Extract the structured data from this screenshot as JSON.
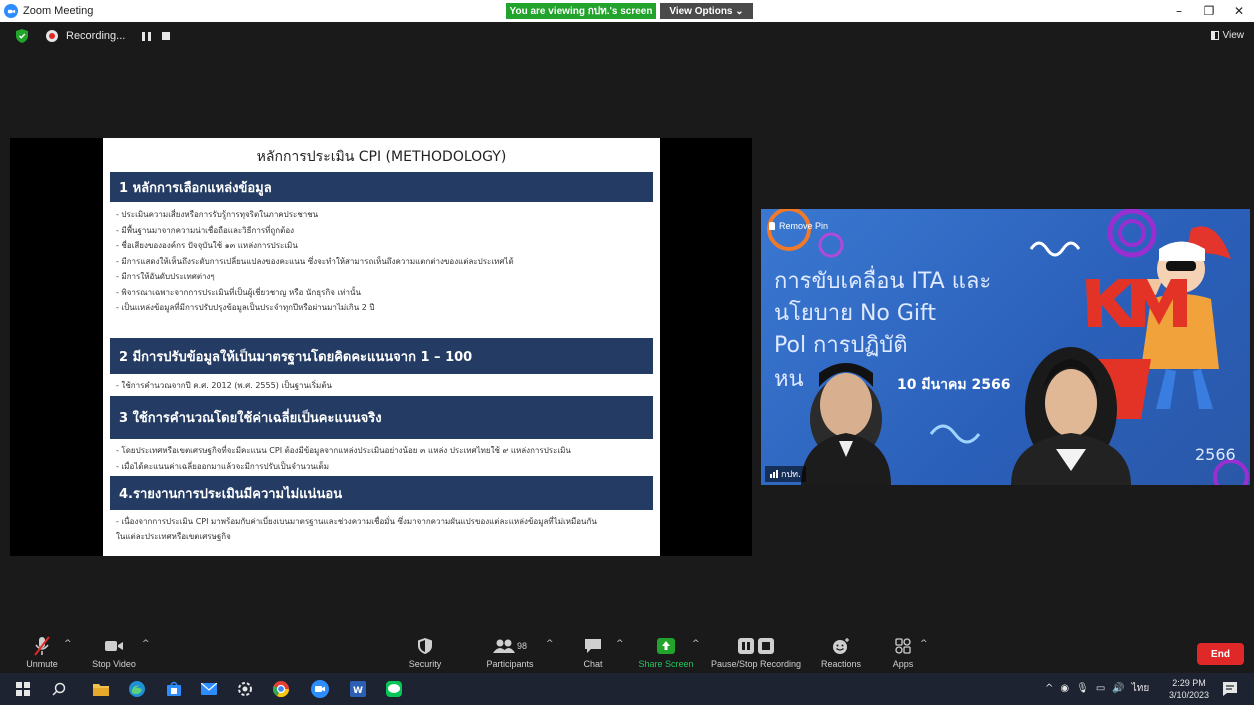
{
  "window": {
    "title": "Zoom Meeting"
  },
  "banner": {
    "viewing": "You are viewing กปท.'s screen",
    "view_options": "View Options ⌄"
  },
  "recording": {
    "label": "Recording...",
    "view": "View"
  },
  "slide": {
    "title": "หลักการประเมิน CPI (METHODOLOGY)",
    "s1": "1 หลักการเลือกแหล่งข้อมูล",
    "s1_items": [
      "- ประเมินความเสี่ยงหรือการรับรู้การทุจริตในภาคประชาชน",
      "- มีพื้นฐานมาจากความน่าเชื่อถือและวิธีการที่ถูกต้อง",
      "- ชื่อเสียงขององค์กร ปัจจุบันใช้ ๑๓ แหล่งการประเมิน",
      "- มีการแสดงให้เห็นถึงระดับการเปลี่ยนแปลงของคะแนน ซึ่งจะทำให้สามารถเห็นถึงความแตกต่างของแต่ละประเทศได้",
      "- มีการให้อันดับประเทศต่างๆ",
      "- พิจารณาเฉพาะจากการประเมินที่เป็นผู้เชี่ยวชาญ หรือ นักธุรกิจ เท่านั้น",
      "- เป็นแหล่งข้อมูลที่มีการปรับปรุงข้อมูลเป็นประจำทุกปีหรือผ่านมาไม่เกิน 2 ปี"
    ],
    "s2": "2 มีการปรับข้อมูลให้เป็นมาตรฐานโดยคิดคะแนนจาก 1 – 100",
    "s2_item": "- ใช้การคำนวณจากปี ค.ศ. 2012 (พ.ศ. 2555) เป็นฐานเริ่มต้น",
    "s3": "3 ใช้การคำนวณโดยใช้ค่าเฉลี่ยเป็นคะแนนจริง",
    "s3_items": [
      "- โดยประเทศหรือเขตเศรษฐกิจที่จะมีคะแนน CPI ต้องมีข้อมูลจากแหล่งประเมินอย่างน้อย ๓ แหล่ง ประเทศไทยใช้ ๙ แหล่งการประเมิน",
      "- เมื่อได้คะแนนค่าเฉลี่ยออกมาแล้วจะมีการปรับเป็นจำนวนเต็ม"
    ],
    "s4": "4.รายงานการประเมินมีความไม่แน่นอน",
    "s4_items": [
      "- เนื่องจากการประเมิน CPI มาพร้อมกับค่าเบี่ยงเบนมาตรฐานและช่วงความเชื่อมั่น ซึ่งมาจากความผันแปรของแต่ละแหล่งข้อมูลที่ไม่เหมือนกัน",
      "ในแต่ละประเทศหรือเขตเศรษฐกิจ"
    ]
  },
  "video": {
    "remove_pin": "Remove Pin",
    "line1": "การขับเคลื่อน ITA และ",
    "line2": "นโยบาย No Gift",
    "line3": "Pol      การปฏิบัติ",
    "line4": "หน",
    "date": "10 มีนาคม 2566",
    "year": "2566",
    "big_letters": "KM",
    "participant_name": "กปท."
  },
  "toolbar": {
    "unmute": "Unmute",
    "stop_video": "Stop Video",
    "security": "Security",
    "participants": "Participants",
    "participants_count": "98",
    "chat": "Chat",
    "share_screen": "Share Screen",
    "pause_recording": "Pause/Stop Recording",
    "reactions": "Reactions",
    "apps": "Apps",
    "end": "End"
  },
  "taskbar": {
    "time": "2:29 PM",
    "date": "3/10/2023",
    "lang": "ไทย"
  },
  "colors": {
    "accent_green": "#22a32b",
    "slide_header": "#243b63",
    "end_red": "#e02828",
    "highlight_red": "#c6201a"
  }
}
